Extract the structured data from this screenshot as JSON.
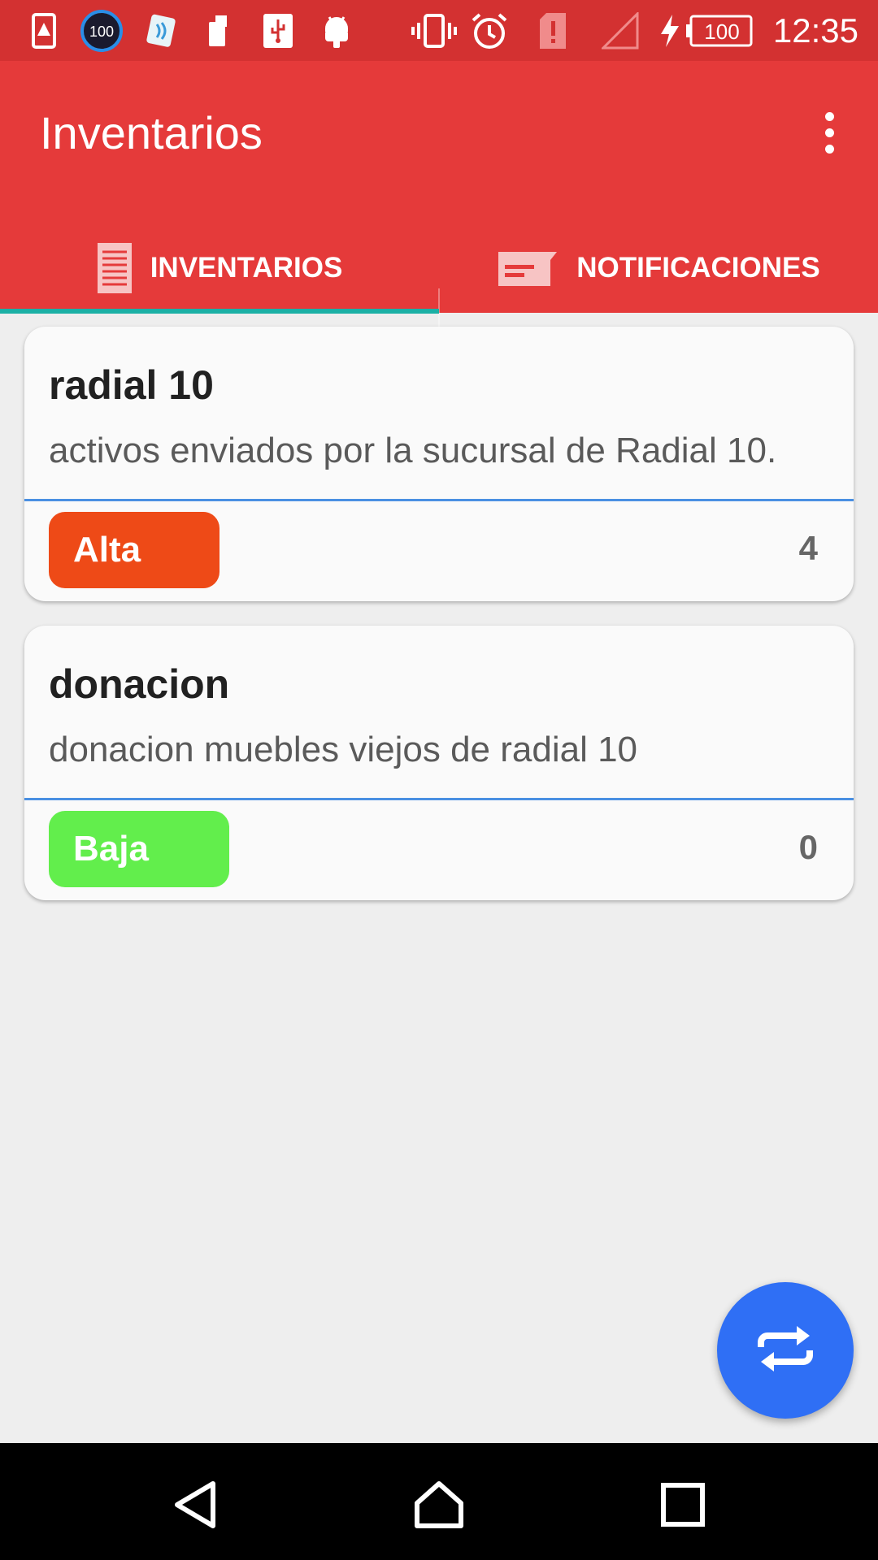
{
  "status_bar": {
    "time": "12:35",
    "battery_level": "100",
    "notification_badge": "100",
    "icons": [
      "sim-alert-icon",
      "badge-100-icon",
      "app-icon",
      "sim-card-icon",
      "usb-icon",
      "android-icon",
      "vibrate-icon",
      "alarm-icon",
      "sim-missing-icon",
      "signal-icon",
      "charging-icon",
      "battery-icon"
    ]
  },
  "app_bar": {
    "title": "Inventarios",
    "overflow_icon": "more-vert-icon",
    "background_color": "#e53a3a"
  },
  "tabs": [
    {
      "label": "INVENTARIOS",
      "icon": "list-icon",
      "selected": true
    },
    {
      "label": "NOTIFICACIONES",
      "icon": "message-icon",
      "selected": false
    }
  ],
  "tab_indicator_color": "#1bb0a5",
  "inventories": [
    {
      "title": "radial 10",
      "description": "activos enviados por la sucursal de Radial 10.",
      "badge": "Alta",
      "badge_color": "#ee4a17",
      "count": "4"
    },
    {
      "title": "donacion",
      "description": "donacion muebles viejos de radial 10",
      "badge": "Baja",
      "badge_color": "#62ee4c",
      "count": "0"
    }
  ],
  "fab": {
    "icon": "sync-icon",
    "color": "#2f6ff5"
  },
  "nav_bar": {
    "back": "back-icon",
    "home": "home-icon",
    "recents": "recents-icon"
  }
}
